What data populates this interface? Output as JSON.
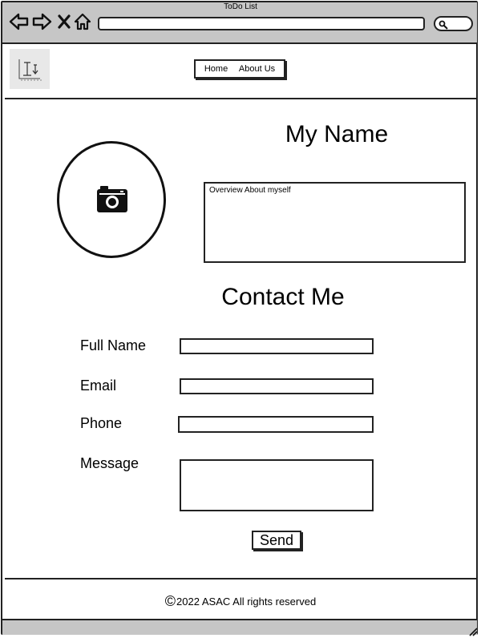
{
  "window": {
    "title": "ToDo List"
  },
  "nav": {
    "home": "Home",
    "about": "About Us"
  },
  "profile": {
    "name": "My Name",
    "overview": "Overview About myself"
  },
  "contact": {
    "heading": "Contact Me",
    "full_name_label": "Full Name",
    "email_label": "Email",
    "phone_label": "Phone",
    "message_label": "Message",
    "full_name_value": "",
    "email_value": "",
    "phone_value": "",
    "message_value": "",
    "send_label": "Send"
  },
  "footer": {
    "symbol": "©",
    "text": "2022 ASAC All rights reserved"
  },
  "colors": {
    "chrome": "#c6c6c6",
    "ink": "#222222"
  },
  "icons": [
    "back-arrow-icon",
    "forward-arrow-icon",
    "close-icon",
    "home-icon",
    "search-icon",
    "camera-icon",
    "resize-grip-icon"
  ]
}
